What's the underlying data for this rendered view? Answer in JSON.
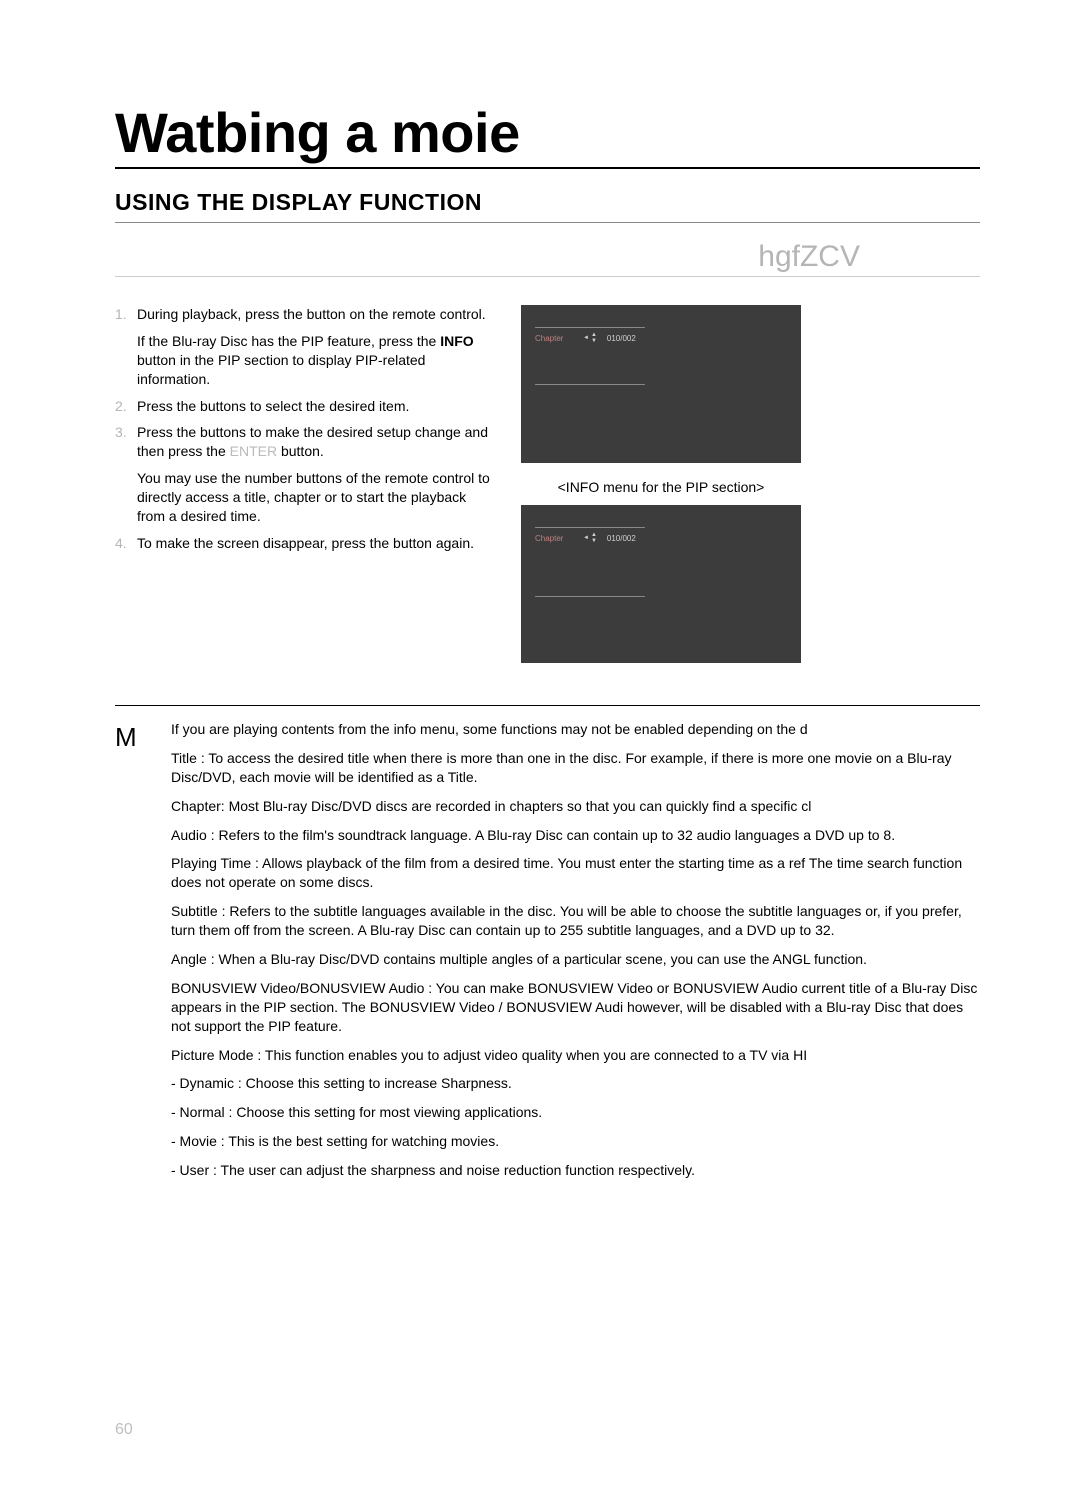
{
  "page": {
    "title": "Watbing a moie",
    "section_heading": "USING THE DISPLAY FUNCTION",
    "media_badges": "hgfZCV",
    "page_number": "60"
  },
  "steps": {
    "s1": {
      "num": "1.",
      "text_a": "During playback, press the ",
      "text_b": " button on the remote control."
    },
    "s1_sub": {
      "a": "If the Blu-ray Disc has the PIP feature, press the ",
      "bold": "INFO",
      "b": " button in the PIP section to display PIP-related information."
    },
    "s2": {
      "num": "2.",
      "text_a": "Press the ",
      "text_b": " buttons to select the desired item."
    },
    "s3": {
      "num": "3.",
      "text_a": "Press the ",
      "text_b": " buttons to make the desired setup change and then press the ",
      "btn": "ENTER",
      "text_c": " button."
    },
    "s3_sub": "You may use the number buttons of the remote control to directly access a title, chapter or to start the playback from a desired time.",
    "s4": {
      "num": "4.",
      "text_a": "To make the screen disappear, press the ",
      "text_b": " button again."
    }
  },
  "caption_pip": "<INFO menu for the PIP section>",
  "preview": {
    "chapter_label": "Chapter",
    "chapter_value": "010/002",
    "arrow_up": "▲",
    "arrow_dn": "▼"
  },
  "notes": {
    "mark": "M",
    "p1": "If you are playing contents from the info menu, some functions may not be enabled depending on the d",
    "p2": "Title : To access the desired title when there is more than one in the disc. For example, if there is more one movie on a Blu-ray Disc/DVD, each movie will be identiﬁed as a Title.",
    "p3": "Chapter: Most Blu-ray Disc/DVD discs are recorded in chapters so that you can quickly ﬁnd a speciﬁc cl",
    "p4": "Audio : Refers to the ﬁlm's soundtrack language. A Blu-ray Disc can contain up to 32 audio languages a DVD up to 8.",
    "p5": "Playing Time : Allows playback of the ﬁlm from a desired time. You must enter the starting time as a ref The time search function does not operate on some discs.",
    "p6": "Subtitle : Refers to the subtitle languages available in the disc. You will be able to choose the subtitle languages or, if you prefer, turn them off from the screen. A Blu-ray Disc can contain up to 255 subtitle languages, and a DVD up to 32.",
    "p7": "Angle : When a Blu-ray Disc/DVD contains multiple angles of a particular scene, you can use the ANGL function.",
    "p8": "BONUSVIEW Video/BONUSVIEW Audio : You can make BONUSVIEW Video or BONUSVIEW Audio current title of a Blu-ray Disc appears in the PIP section. The BONUSVIEW Video / BONUSVIEW Audi however, will be disabled with a Blu-ray Disc that does not support the PIP feature.",
    "p9": "Picture Mode : This function enables you to adjust video quality when you are connected to a TV via HI",
    "p9a": "- Dynamic : Choose this setting to increase Sharpness.",
    "p9b": "- Normal : Choose this setting for most viewing applications.",
    "p9c": "- Movie : This is the best setting for watching movies.",
    "p9d": "- User : The user can adjust the sharpness and noise reduction function respectively."
  }
}
